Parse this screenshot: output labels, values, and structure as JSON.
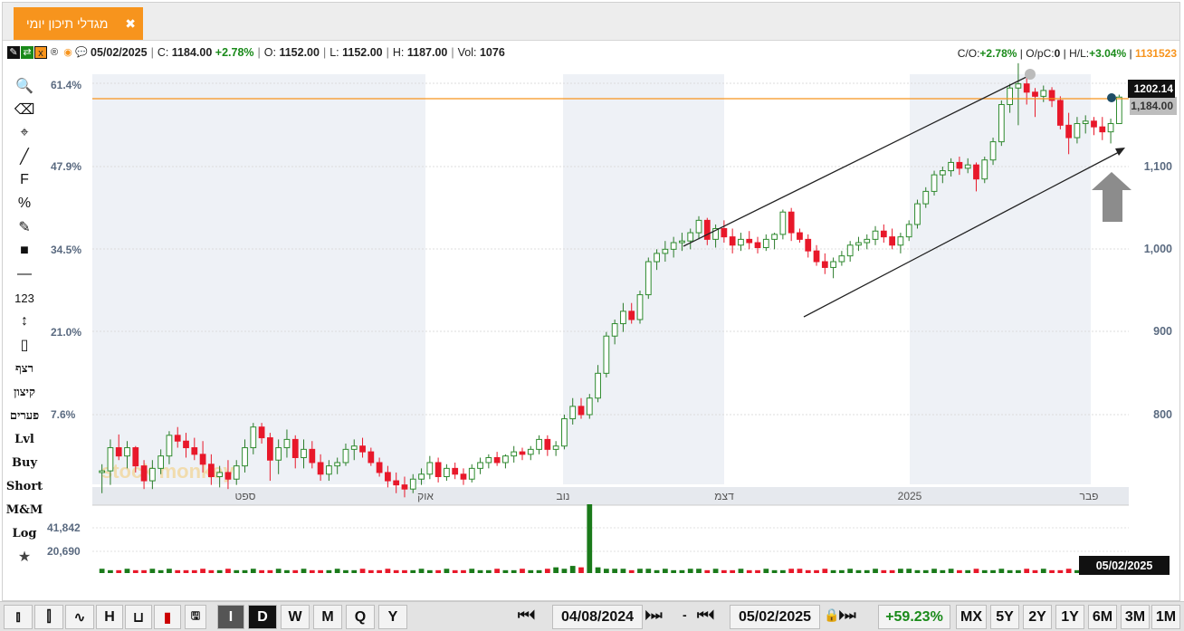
{
  "tab": {
    "title": "מגדלי תיכון יומי",
    "close": "✖"
  },
  "info": {
    "date": "05/02/2025",
    "close_label": "C:",
    "close": "1184.00",
    "change": "+2.78%",
    "open_label": "O:",
    "open": "1152.00",
    "low_label": "L:",
    "low": "1152.00",
    "high_label": "H:",
    "high": "1187.00",
    "vol_label": "Vol:",
    "vol": "1076",
    "co_label": "C/O:",
    "co": "+2.78%",
    "opc_label": "O/pC:",
    "opc": "0",
    "hl_label": "H/L:",
    "hl": "+3.04%",
    "id": "1131523"
  },
  "left_tools": [
    "🔍",
    "⌫",
    "⌖",
    "╱",
    "F",
    "%",
    "✎",
    "■",
    "—",
    "123",
    "↕",
    "▯",
    "רצף",
    "קיצון",
    "פערים",
    "Lvl",
    "Buy",
    "Short",
    "M&M",
    "Log",
    "★"
  ],
  "chart_data": {
    "type": "candlestick",
    "y_right_ticks": [
      "1,100",
      "1,000",
      "900",
      "800"
    ],
    "y_left_ticks": [
      "61.4%",
      "47.9%",
      "34.5%",
      "21.0%",
      "7.6%"
    ],
    "x_labels": [
      "ספט",
      "אוק",
      "נוב",
      "דצמ",
      "2025",
      "פבר"
    ],
    "last_price_label": "1,184.00",
    "cursor_price_label": "1202.14",
    "volume_ticks": [
      "41,842",
      "20,690"
    ],
    "cursor_date_label": "05/02/2025",
    "watermark": "stock monkey",
    "candles": [
      [
        730,
        740,
        705,
        732
      ],
      [
        732,
        770,
        715,
        760
      ],
      [
        760,
        776,
        745,
        750
      ],
      [
        750,
        768,
        735,
        760
      ],
      [
        760,
        762,
        730,
        738
      ],
      [
        738,
        745,
        710,
        720
      ],
      [
        720,
        745,
        710,
        735
      ],
      [
        735,
        758,
        728,
        750
      ],
      [
        750,
        780,
        740,
        775
      ],
      [
        775,
        785,
        760,
        768
      ],
      [
        768,
        778,
        748,
        760
      ],
      [
        760,
        772,
        745,
        752
      ],
      [
        752,
        768,
        730,
        740
      ],
      [
        740,
        752,
        715,
        725
      ],
      [
        725,
        738,
        712,
        730
      ],
      [
        730,
        745,
        710,
        722
      ],
      [
        722,
        745,
        715,
        738
      ],
      [
        738,
        770,
        730,
        760
      ],
      [
        760,
        790,
        752,
        785
      ],
      [
        785,
        790,
        765,
        772
      ],
      [
        772,
        778,
        720,
        745
      ],
      [
        745,
        770,
        728,
        760
      ],
      [
        760,
        782,
        748,
        770
      ],
      [
        770,
        775,
        735,
        748
      ],
      [
        748,
        770,
        735,
        758
      ],
      [
        758,
        768,
        735,
        742
      ],
      [
        742,
        752,
        720,
        728
      ],
      [
        728,
        745,
        720,
        738
      ],
      [
        738,
        748,
        728,
        742
      ],
      [
        742,
        765,
        738,
        758
      ],
      [
        758,
        770,
        745,
        762
      ],
      [
        762,
        772,
        748,
        755
      ],
      [
        755,
        760,
        738,
        742
      ],
      [
        742,
        748,
        725,
        730
      ],
      [
        730,
        738,
        712,
        720
      ],
      [
        720,
        730,
        705,
        715
      ],
      [
        715,
        725,
        700,
        710
      ],
      [
        710,
        728,
        705,
        722
      ],
      [
        722,
        735,
        715,
        728
      ],
      [
        728,
        750,
        722,
        742
      ],
      [
        742,
        748,
        718,
        725
      ],
      [
        725,
        740,
        720,
        735
      ],
      [
        735,
        742,
        722,
        728
      ],
      [
        728,
        735,
        715,
        722
      ],
      [
        722,
        740,
        718,
        735
      ],
      [
        735,
        748,
        728,
        742
      ],
      [
        742,
        752,
        735,
        748
      ],
      [
        748,
        755,
        738,
        742
      ],
      [
        742,
        752,
        735,
        750
      ],
      [
        750,
        762,
        742,
        755
      ],
      [
        755,
        760,
        745,
        752
      ],
      [
        752,
        762,
        745,
        758
      ],
      [
        758,
        775,
        752,
        770
      ],
      [
        770,
        775,
        750,
        758
      ],
      [
        758,
        768,
        750,
        762
      ],
      [
        762,
        800,
        758,
        795
      ],
      [
        795,
        820,
        788,
        810
      ],
      [
        810,
        820,
        795,
        800
      ],
      [
        800,
        825,
        795,
        820
      ],
      [
        820,
        860,
        815,
        850
      ],
      [
        850,
        900,
        845,
        895
      ],
      [
        895,
        915,
        885,
        910
      ],
      [
        910,
        935,
        900,
        925
      ],
      [
        925,
        935,
        910,
        915
      ],
      [
        915,
        950,
        910,
        945
      ],
      [
        945,
        990,
        940,
        985
      ],
      [
        985,
        1000,
        975,
        995
      ],
      [
        995,
        1010,
        985,
        1000
      ],
      [
        1000,
        1015,
        990,
        1008
      ],
      [
        1008,
        1020,
        998,
        1010
      ],
      [
        1010,
        1025,
        1000,
        1020
      ],
      [
        1020,
        1040,
        1012,
        1035
      ],
      [
        1035,
        1038,
        1005,
        1012
      ],
      [
        1012,
        1030,
        1002,
        1025
      ],
      [
        1025,
        1035,
        1008,
        1015
      ],
      [
        1015,
        1025,
        995,
        1005
      ],
      [
        1005,
        1020,
        998,
        1012
      ],
      [
        1012,
        1022,
        1000,
        1008
      ],
      [
        1008,
        1015,
        995,
        1002
      ],
      [
        1002,
        1018,
        998,
        1012
      ],
      [
        1012,
        1020,
        1000,
        1018
      ],
      [
        1018,
        1048,
        1012,
        1045
      ],
      [
        1045,
        1050,
        1010,
        1020
      ],
      [
        1020,
        1025,
        1008,
        1012
      ],
      [
        1012,
        1018,
        990,
        998
      ],
      [
        998,
        1005,
        980,
        985
      ],
      [
        985,
        995,
        970,
        978
      ],
      [
        978,
        990,
        965,
        985
      ],
      [
        985,
        998,
        980,
        992
      ],
      [
        992,
        1010,
        985,
        1005
      ],
      [
        1005,
        1015,
        998,
        1008
      ],
      [
        1008,
        1018,
        1000,
        1012
      ],
      [
        1012,
        1028,
        1005,
        1022
      ],
      [
        1022,
        1030,
        1008,
        1015
      ],
      [
        1015,
        1025,
        1000,
        1005
      ],
      [
        1005,
        1020,
        995,
        1015
      ],
      [
        1015,
        1035,
        1010,
        1030
      ],
      [
        1030,
        1060,
        1025,
        1055
      ],
      [
        1055,
        1075,
        1050,
        1070
      ],
      [
        1070,
        1095,
        1065,
        1090
      ],
      [
        1090,
        1100,
        1080,
        1095
      ],
      [
        1095,
        1110,
        1088,
        1105
      ],
      [
        1105,
        1112,
        1090,
        1098
      ],
      [
        1098,
        1110,
        1092,
        1102
      ],
      [
        1102,
        1105,
        1070,
        1085
      ],
      [
        1085,
        1112,
        1080,
        1108
      ],
      [
        1108,
        1135,
        1102,
        1130
      ],
      [
        1130,
        1180,
        1125,
        1175
      ],
      [
        1175,
        1200,
        1165,
        1195
      ],
      [
        1195,
        1225,
        1150,
        1200
      ],
      [
        1200,
        1210,
        1175,
        1190
      ],
      [
        1190,
        1195,
        1160,
        1185
      ],
      [
        1185,
        1198,
        1178,
        1192
      ],
      [
        1192,
        1196,
        1172,
        1180
      ],
      [
        1180,
        1185,
        1145,
        1150
      ],
      [
        1150,
        1165,
        1115,
        1135
      ],
      [
        1135,
        1160,
        1128,
        1152
      ],
      [
        1152,
        1162,
        1140,
        1155
      ],
      [
        1155,
        1160,
        1138,
        1148
      ],
      [
        1148,
        1160,
        1132,
        1142
      ],
      [
        1142,
        1158,
        1128,
        1152
      ],
      [
        1152,
        1187,
        1152,
        1184
      ]
    ],
    "volumes": [
      3,
      2,
      2,
      3,
      2,
      2,
      3,
      2,
      3,
      2,
      2,
      2,
      3,
      2,
      2,
      3,
      2,
      2,
      3,
      2,
      2,
      3,
      2,
      2,
      3,
      2,
      2,
      2,
      3,
      2,
      2,
      3,
      2,
      2,
      3,
      2,
      2,
      2,
      3,
      2,
      2,
      3,
      2,
      2,
      3,
      2,
      2,
      3,
      2,
      2,
      3,
      2,
      2,
      3,
      4,
      3,
      5,
      4,
      48,
      4,
      3,
      3,
      3,
      2,
      3,
      3,
      2,
      3,
      2,
      2,
      3,
      3,
      2,
      3,
      2,
      2,
      3,
      2,
      2,
      3,
      2,
      2,
      3,
      3,
      2,
      2,
      3,
      2,
      2,
      3,
      2,
      2,
      3,
      2,
      2,
      3,
      3,
      2,
      2,
      3,
      2,
      3,
      2,
      2,
      3,
      2,
      2,
      3,
      2,
      2,
      3,
      2,
      3,
      2,
      2,
      3,
      2,
      2,
      3,
      2,
      2
    ]
  },
  "bottom": {
    "range_start": "04/08/2024",
    "range_end": "05/02/2025",
    "change": "+59.23%",
    "period_buttons": [
      "MX",
      "5Y",
      "2Y",
      "1Y",
      "6M",
      "3M",
      "1M"
    ],
    "interval_buttons": [
      "I",
      "D",
      "W",
      "M",
      "Q",
      "Y"
    ],
    "sep": "-"
  },
  "colors": {
    "up": "#2e8b2e",
    "down": "#e8182a",
    "accent": "#f7941d",
    "band": "#eef1f6"
  }
}
